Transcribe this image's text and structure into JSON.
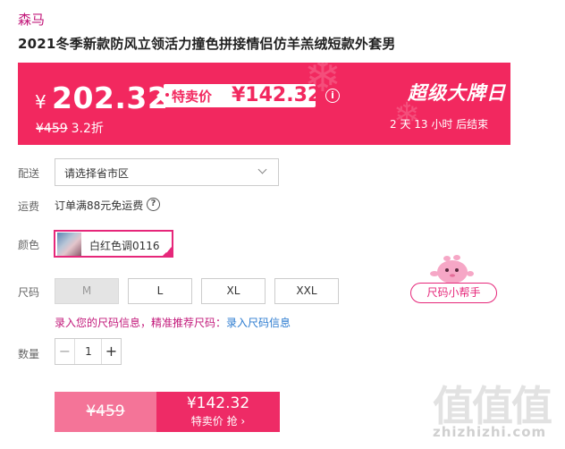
{
  "brand": "森马",
  "title": "2021冬季新款防风立领活力撞色拼接情侣仿羊羔绒短款外套男",
  "price": {
    "currency": "¥",
    "current": "202.32",
    "special_label": "特卖价",
    "special_value": "¥142.32",
    "original": "¥459",
    "discount": "3.2折",
    "promo_title": "超级大牌日",
    "countdown": "2 天 13 小时 后结束",
    "accent_color": "#f2285f"
  },
  "delivery": {
    "label": "配送",
    "placeholder": "请选择省市区"
  },
  "shipping": {
    "label": "运费",
    "text": "订单满88元免运费",
    "help_icon": "?"
  },
  "color": {
    "label": "颜色",
    "selected": "白红色调0116"
  },
  "size": {
    "label": "尺码",
    "options": [
      "M",
      "L",
      "XL",
      "XXL"
    ],
    "disabled": [
      "M"
    ],
    "helper": "尺码小帮手",
    "info_text": "录入您的尺码信息，精准推荐尺码：",
    "info_link": "录入尺码信息"
  },
  "quantity": {
    "label": "数量",
    "value": "1",
    "minus": "−",
    "plus": "+"
  },
  "buy": {
    "original_price": "¥459",
    "special_price": "¥142.32",
    "special_label": "特卖价 抢 ›"
  },
  "watermark": {
    "text": "值值值",
    "url": "zhizhizhi.com"
  }
}
